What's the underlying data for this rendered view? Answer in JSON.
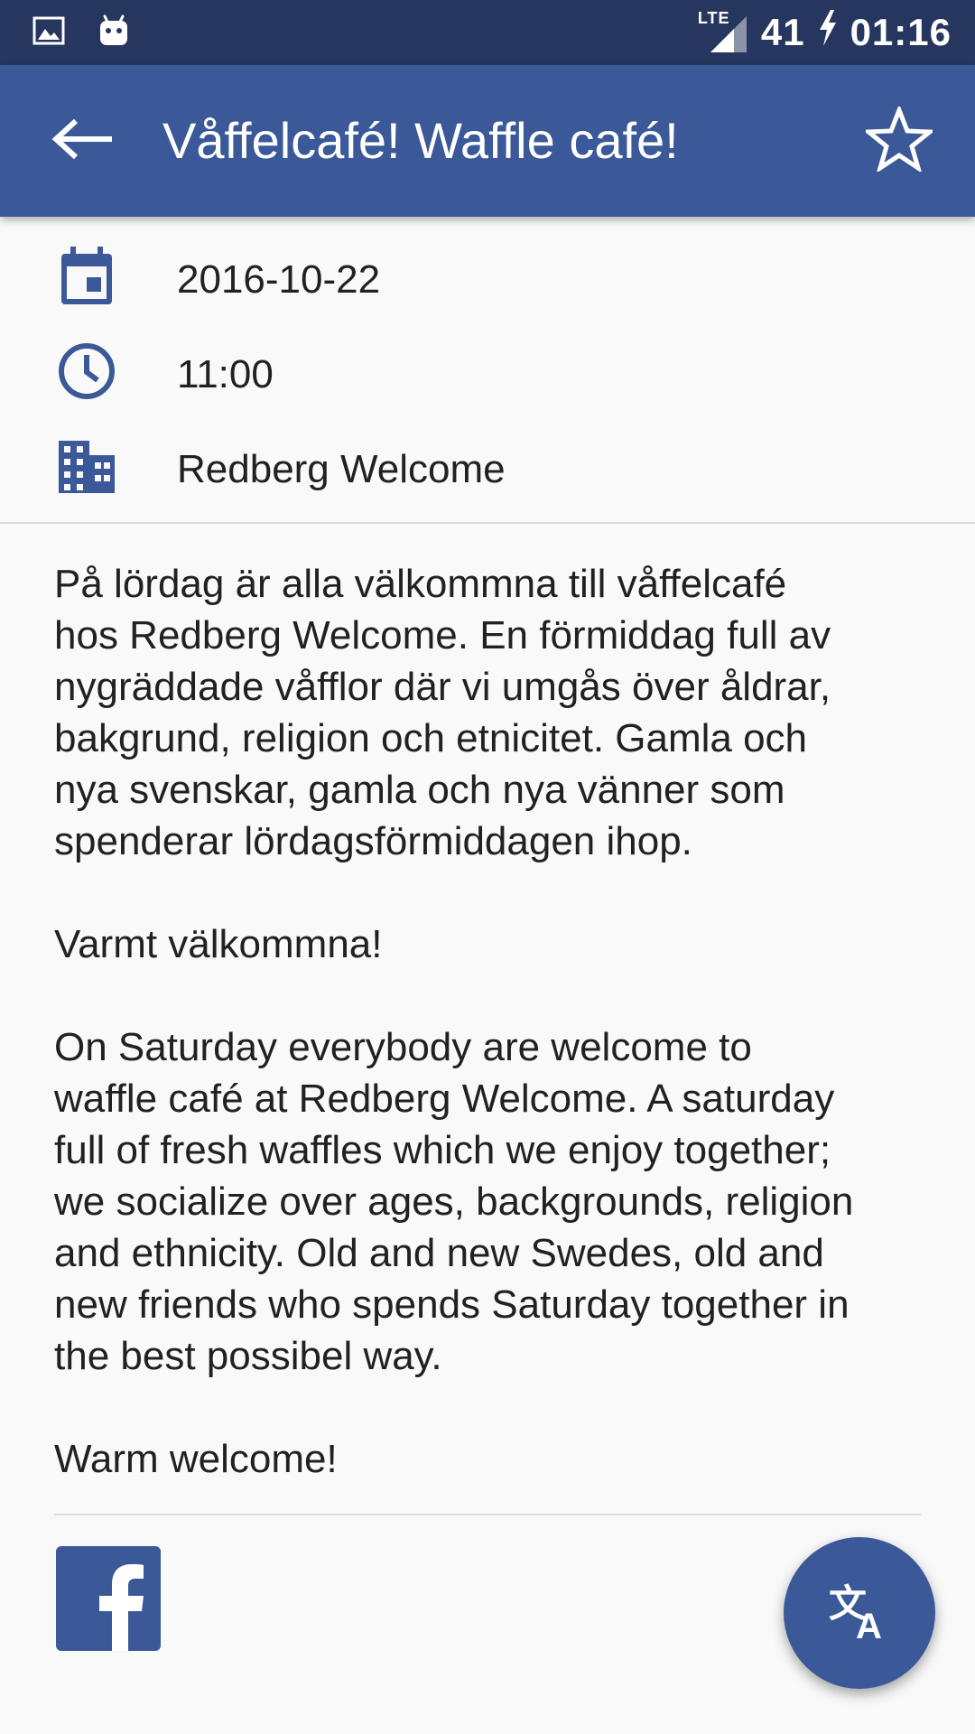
{
  "status_bar": {
    "network": "LTE",
    "battery": "41",
    "time": "01:16",
    "icons": [
      "image-icon",
      "android-icon",
      "signal-icon",
      "charging-icon"
    ]
  },
  "app_bar": {
    "title": "Våffelcafé! Waffle café!",
    "icons": [
      "back-arrow-icon",
      "star-outline-icon"
    ]
  },
  "event": {
    "date": "2016-10-22",
    "time": "11:00",
    "organizer": "Redberg Welcome",
    "icons": [
      "calendar-icon",
      "clock-icon",
      "building-icon"
    ]
  },
  "description": {
    "paragraphs": [
      [
        "På lördag är alla välkommna till våffelcafé",
        "hos Redberg Welcome. En förmiddag full av",
        "nygräddade våfflor där vi umgås över åldrar,",
        "bakgrund, religion och etnicitet. Gamla och",
        "nya svenskar, gamla och nya vänner som",
        "spenderar lördagsförmiddagen ihop."
      ],
      [
        "Varmt välkommna!"
      ],
      [
        "On Saturday everybody are welcome to",
        "waffle café at Redberg Welcome. A saturday",
        "full of fresh waffles which we enjoy together;",
        "we socialize over ages, backgrounds, religion",
        "and ethnicity. Old and new Swedes, old and",
        "new friends who spends Saturday together in",
        "the best possibel way."
      ],
      [
        "Warm welcome!"
      ]
    ]
  },
  "footer": {
    "icons": [
      "facebook-icon",
      "translate-icon"
    ]
  },
  "colors": {
    "status_bar": "#26365e",
    "app_bar": "#3b5998",
    "accent": "#3b5998",
    "background": "#f9f9f9"
  }
}
